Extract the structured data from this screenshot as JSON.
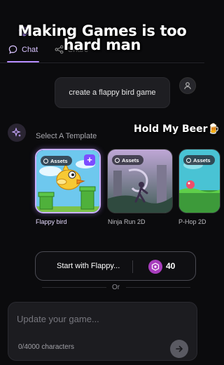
{
  "overlay": {
    "caption_line1": "Making Games is too",
    "caption_line2": "hard man",
    "caption_beer": "Hold My Beer🍺"
  },
  "tabs": [
    {
      "label": "Chat",
      "icon": "chat-bubble-icon",
      "active": true
    },
    {
      "label": "Share",
      "icon": "share-icon",
      "active": false
    }
  ],
  "conversation": {
    "user_message": "create a flappy bird game",
    "select_template_label": "Select A Template"
  },
  "templates": [
    {
      "name": "Flappy bird",
      "badge": "Assets",
      "selected": true
    },
    {
      "name": "Ninja Run 2D",
      "badge": "Assets",
      "selected": false
    },
    {
      "name": "P-Hop 2D",
      "badge": "Assets",
      "selected": false
    }
  ],
  "start_button": {
    "label": "Start with Flappy...",
    "credits": "40"
  },
  "separator_text": "Or",
  "composer": {
    "placeholder": "Update your game...",
    "char_count": "0/4000 characters"
  },
  "colors": {
    "background": "#0b0b0d",
    "accent": "#b78cff",
    "credit": "#a83dbd"
  }
}
